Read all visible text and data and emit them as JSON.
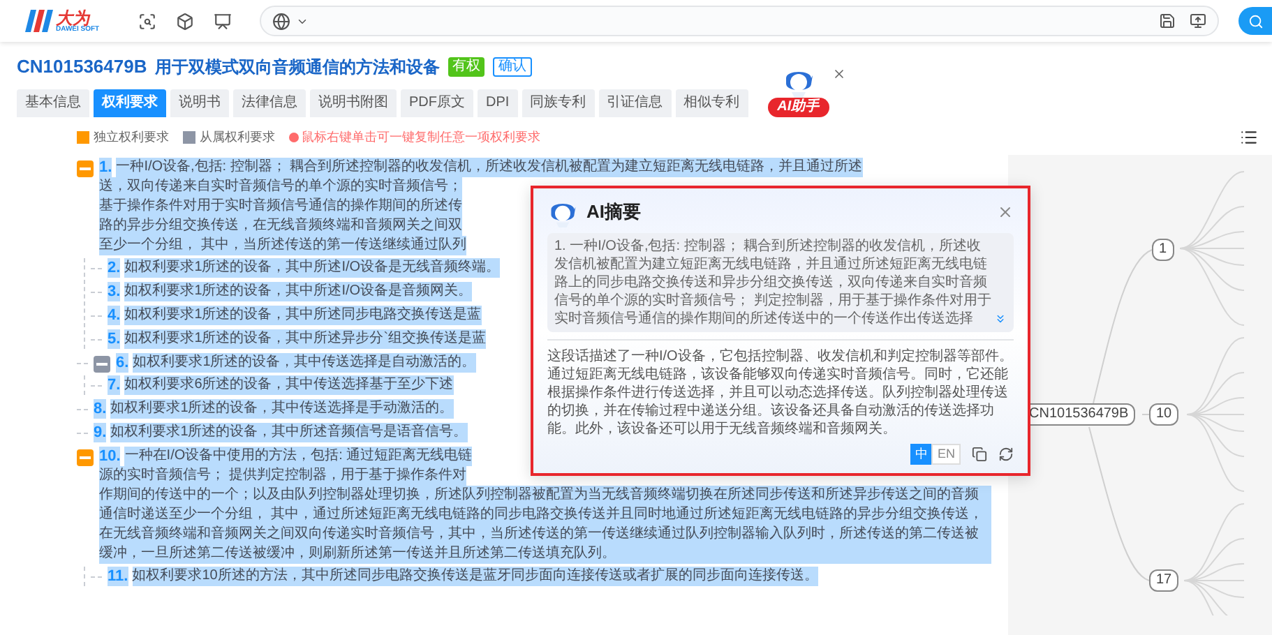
{
  "header": {
    "logo_title": "大为",
    "logo_subtitle": "DAWEI SOFT"
  },
  "patent": {
    "number": "CN101536479B",
    "title": "用于双模式双向音频通信的方法和设备",
    "status": "有权",
    "action": "确认"
  },
  "tabs": [
    {
      "label": "基本信息",
      "selected": false
    },
    {
      "label": "权利要求",
      "selected": true
    },
    {
      "label": "说明书",
      "selected": false
    },
    {
      "label": "法律信息",
      "selected": false
    },
    {
      "label": "说明书附图",
      "selected": false
    },
    {
      "label": "PDF原文",
      "selected": false
    },
    {
      "label": "DPI",
      "selected": false
    },
    {
      "label": "同族专利",
      "selected": false
    },
    {
      "label": "引证信息",
      "selected": false
    },
    {
      "label": "相似专利",
      "selected": false
    }
  ],
  "assistant": {
    "label": "AI助手"
  },
  "legend": [
    {
      "label": "独立权利要求",
      "color": "#ff9800"
    },
    {
      "label": "从属权利要求",
      "color": "#8d95a5"
    }
  ],
  "hint": "鼠标右键单击可一键复制任意一项权利要求",
  "claims": [
    {
      "number": "1.",
      "kind": "independent",
      "expanded": true,
      "lines": [
        "一种I/O设备,包括: 控制器； 耦合到所述控制器的收发信机，所述收发信机被配置为建立短距离无线电链路，并且通过所述",
        "送，双向传递来自实时音频信号的单个源的实时音频信号；",
        "基于操作条件对用于实时音频信号通信的操作期间的所述传",
        "路的异步分组交换传送，在无线音频终端和音频网关之间双",
        "至少一个分组， 其中，当所述传送的第一传送继续通过队列"
      ],
      "children": [
        {
          "number": "2.",
          "kind": "dependent",
          "lines": [
            "如权利要求1所述的设备，其中所述I/O设备是无线音频终端。"
          ]
        },
        {
          "number": "3.",
          "kind": "dependent",
          "lines": [
            "如权利要求1所述的设备，其中所述I/O设备是音频网关。"
          ]
        },
        {
          "number": "4.",
          "kind": "dependent",
          "lines": [
            "如权利要求1所述的设备，其中所述同步电路交换传送是蓝"
          ]
        },
        {
          "number": "5.",
          "kind": "dependent",
          "lines": [
            "如权利要求1所述的设备，其中所述异步分`组交换传送是蓝"
          ]
        }
      ]
    },
    {
      "number": "6.",
      "kind": "dependent",
      "expanded": true,
      "lines": [
        "如权利要求1所述的设备，其中传送选择是自动激活的。"
      ],
      "children": [
        {
          "number": "7.",
          "kind": "dependent",
          "lines": [
            "如权利要求6所述的设备，其中传送选择基于至少下述"
          ]
        }
      ]
    },
    {
      "number": "8.",
      "kind": "dependent",
      "lines": [
        "如权利要求1所述的设备，其中传送选择是手动激活的。"
      ]
    },
    {
      "number": "9.",
      "kind": "dependent",
      "lines": [
        "如权利要求1所述的设备，其中所述音频信号是语音信号。"
      ]
    },
    {
      "number": "10.",
      "kind": "independent",
      "expanded": true,
      "lines": [
        "一种在I/O设备中使用的方法，包括: 通过短距离无线电链",
        "源的实时音频信号； 提供判定控制器，用于基于操作条件对",
        "作期间的传送中的一个；以及由队列控制器处理切换，所述队列控制器被配置为当无线音频终端切换在所述同步传送和所述异步传送之间的音频通信时递送至少一个分组， 其中，通过所述短距离无线电链路的同步电路交换传送并且同时地通过所述短距离无线电链路的异步分组交换传送，在无线音频终端和音频网关之间双向传递实时音频信号，其中，当所述传送的第一传送继续通过队列控制器输入队列时，所述传送的第二传送被缓冲，一旦所述第二传送被缓冲，则刷新所述第一传送并且所述第二传送填充队列。"
      ],
      "children": [
        {
          "number": "11.",
          "kind": "dependent",
          "lines": [
            "如权利要求10所述的方法，其中所述同步电路交换传送是蓝牙同步面向连接传送或者扩展的同步面向连接传送。"
          ]
        }
      ]
    }
  ],
  "ai_summary": {
    "title": "AI摘要",
    "quote": "1. 一种I/O设备,包括: 控制器； 耦合到所述控制器的收发信机，所述收发信机被配置为建立短距离无线电链路，并且通过所述短距离无线电链路上的同步电路交换传送和异步分组交换传送，双向传递来自实时音频信号的单个源的实时音频信号； 判定控制器，用于基于操作条件对用于实时音频信号通信的操作期间的所述传送中的一个传送作出传送选择",
    "summary": "这段话描述了一种I/O设备，它包括控制器、收发信机和判定控制器等部件。通过短距离无线电链路，该设备能够双向传递实时音频信号。同时，它还能根据操作条件进行传送选择，并且可以动态选择传送。队列控制器处理传送的切换，并在传输过程中递送分组。该设备还具备自动激活的传送选择功能。此外，该设备还可以用于无线音频终端和音频网关。",
    "languages": [
      {
        "label": "中",
        "selected": true
      },
      {
        "label": "EN",
        "selected": false
      }
    ]
  },
  "mind_map": {
    "nodes": [
      {
        "label": "CN101536479B"
      },
      {
        "label": "1"
      },
      {
        "label": "10"
      },
      {
        "label": "17"
      }
    ]
  }
}
